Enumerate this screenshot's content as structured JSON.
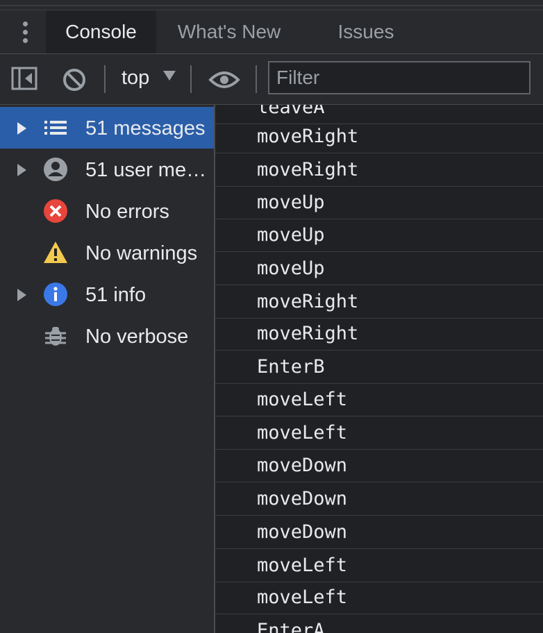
{
  "tabs": [
    {
      "label": "Console",
      "active": true
    },
    {
      "label": "What's New",
      "active": false
    },
    {
      "label": "Issues",
      "active": false
    }
  ],
  "toolbar": {
    "context_label": "top",
    "filter_placeholder": "Filter"
  },
  "sidebar": {
    "items": [
      {
        "label": "51 messages",
        "icon": "list-icon",
        "expandable": true,
        "selected": true
      },
      {
        "label": "51 user me…",
        "icon": "user-icon",
        "expandable": true,
        "selected": false
      },
      {
        "label": "No errors",
        "icon": "error-icon",
        "expandable": false,
        "selected": false
      },
      {
        "label": "No warnings",
        "icon": "warning-icon",
        "expandable": false,
        "selected": false
      },
      {
        "label": "51 info",
        "icon": "info-icon",
        "expandable": true,
        "selected": false
      },
      {
        "label": "No verbose",
        "icon": "bug-icon",
        "expandable": false,
        "selected": false
      }
    ]
  },
  "console": {
    "messages": [
      "leaveA",
      "moveRight",
      "moveRight",
      "moveUp",
      "moveUp",
      "moveUp",
      "moveRight",
      "moveRight",
      "EnterB",
      "moveLeft",
      "moveLeft",
      "moveDown",
      "moveDown",
      "moveDown",
      "moveLeft",
      "moveLeft",
      "EnterA"
    ]
  },
  "colors": {
    "selected_bg": "#2b5ea9",
    "error": "#e8453c",
    "warning": "#f2c94c",
    "info": "#3b78e7"
  }
}
